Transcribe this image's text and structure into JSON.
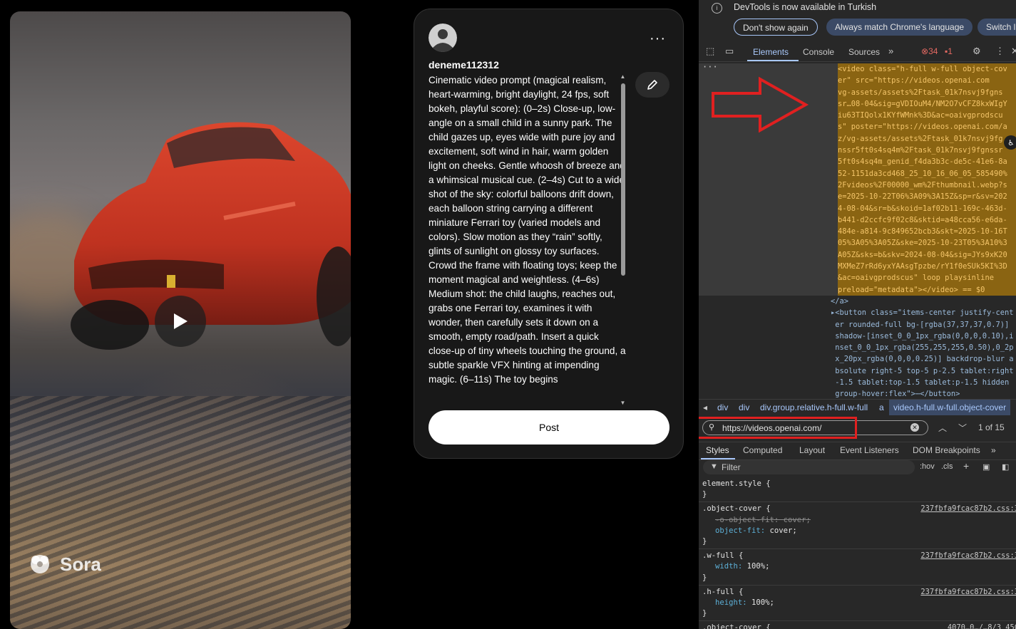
{
  "video": {
    "brand": "Sora",
    "play_label": "Play"
  },
  "composer": {
    "username": "deneme112312",
    "prompt": "Cinematic video prompt (magical realism, heart-warming, bright daylight, 24 fps, soft bokeh, playful score): (0–2s) Close-up, low-angle on a small child in a sunny park. The child gazes up, eyes wide with pure joy and excitement, soft wind in hair, warm golden light on cheeks. Gentle whoosh of breeze and a whimsical musical cue. (2–4s) Cut to a wide shot of the sky: colorful balloons drift down, each balloon string carrying a different miniature Ferrari toy (varied models and colors). Slow motion as they “rain” softly, glints of sunlight on glossy toy surfaces. Crowd the frame with floating toys; keep the moment magical and weightless. (4–6s) Medium shot: the child laughs, reaches out, grabs one Ferrari toy, examines it with wonder, then carefully sets it down on a smooth, empty road/path. Insert a quick close-up of tiny wheels touching the ground, a subtle sparkle VFX hinting at impending magic. (6–11s) The toy begins",
    "post_label": "Post",
    "more_label": "···"
  },
  "devtools": {
    "info_message": "DevTools is now available in Turkish",
    "btn_dont_show": "Don't show again",
    "btn_match_lang": "Always match Chrome's language",
    "btn_switch": "Switch l",
    "tabs": [
      "Elements",
      "Console",
      "Sources"
    ],
    "active_tab": "Elements",
    "errors": "34",
    "warnings": "1",
    "dom_lines": [
      "<video class=\"h-full w-full object-cov",
      "er\" src=\"https://videos.openai.com",
      "vg-assets/assets%2Ftask_01k7nsvj9fgns",
      "sr…08-04&sig=gVDIOuM4/NM2O7vCFZ8kxWIgY",
      "iu63TIQolx1KYfWMnk%3D&ac=oaivgprodscu",
      "s\" poster=\"https://videos.openai.com/a",
      "z/vg-assets/assets%2Ftask_01k7nsvj9fg",
      "nssr5ft0s4sq4m%2Ftask_01k7nsvj9fgnssr",
      "5ft0s4sq4m_genid_f4da3b3c-de5c-41e6-8a",
      "52-1151da3cd468_25_10_16_06_05_585490%",
      "2Fvideos%2F00000_wm%2Fthumbnail.webp?s",
      "e=2025-10-22T06%3A09%3A15Z&sp=r&sv=202",
      "4-08-04&sr=b&skoid=1af02b11-169c-463d-",
      "b441-d2ccfc9f02c8&sktid=a48cca56-e6da-",
      "484e-a814-9c849652bcb3&skt=2025-10-16T",
      "05%3A05%3A05Z&ske=2025-10-23T05%3A10%3",
      "A05Z&sks=b&skv=2024-08-04&sig=JYs9xK20",
      "MXMeZ7rRd6yxYAAsgTpzbe/rY1f0eSUk5KI%3D",
      "&ac=oaivgprodscus\" loop playsinline",
      "preload=\"metadata\"></video> == $0"
    ],
    "dom_rest": [
      "</a>",
      "▸<button class=\"items-center justify-cent",
      " er rounded-full bg-[rgba(37,37,37,0.7)]",
      " shadow-[inset_0_0_1px_rgba(0,0,0,0.10),i",
      " nset_0_0_1px_rgba(255,255,255,0.50),0_2p",
      " x_20px_rgba(0,0,0,0.25)] backdrop-blur a",
      " bsolute right-5 top-5 p-2.5 tablet:right",
      " -1.5 tablet:top-1.5 tablet:p-1.5 hidden",
      " group-hover:flex\">⋯</button>"
    ],
    "breadcrumbs": [
      "div",
      "div",
      "div.group.relative.h-full.w-full",
      "a",
      "video.h-full.w-full.object-cover"
    ],
    "search_value": "https://videos.openai.com/",
    "match_count": "1 of 15",
    "styles_tabs": [
      "Styles",
      "Computed",
      "Layout",
      "Event Listeners",
      "DOM Breakpoints"
    ],
    "filter_placeholder": "Filter",
    "hov_label": ":hov",
    "cls_label": ".cls",
    "rules": [
      {
        "selector": "element.style {",
        "source": "",
        "props": [],
        "close": "}"
      },
      {
        "selector": ".object-cover {",
        "source": "237fbfa9fcac87b2.css:3",
        "props": [
          {
            "name": "-o-object-fit",
            "value": "cover;",
            "struck": true
          },
          {
            "name": "object-fit",
            "value": "cover;",
            "struck": false
          }
        ],
        "close": "}"
      },
      {
        "selector": ".w-full {",
        "source": "237fbfa9fcac87b2.css:3",
        "props": [
          {
            "name": "width",
            "value": "100%;",
            "struck": false
          }
        ],
        "close": "}"
      },
      {
        "selector": ".h-full {",
        "source": "237fbfa9fcac87b2.css:3",
        "props": [
          {
            "name": "height",
            "value": "100%;",
            "struck": false
          }
        ],
        "close": "}"
      },
      {
        "selector": ".object-cover {",
        "source": "4070…0…/…8/3 45C",
        "props": [],
        "close": ""
      }
    ]
  }
}
